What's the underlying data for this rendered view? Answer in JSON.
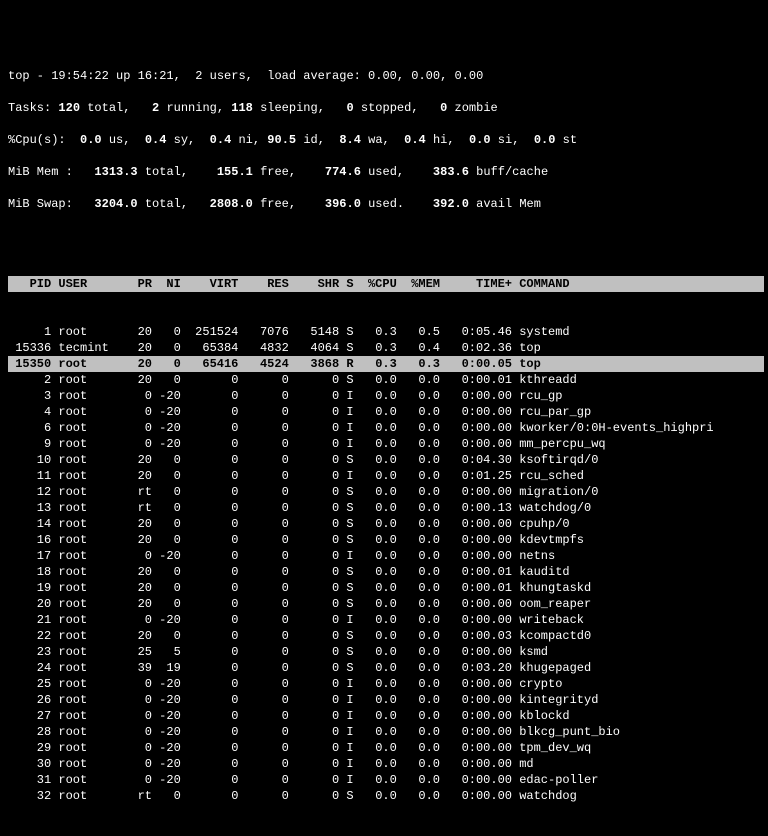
{
  "summary": {
    "line1": "top - 19:54:22 up 16:21,  2 users,  load average: 0.00, 0.00, 0.00",
    "tasks_prefix": "Tasks:",
    "tasks_total": "120",
    "tasks_running": "2",
    "tasks_sleeping": "118",
    "tasks_stopped": "0",
    "tasks_zombie": "0",
    "cpu_prefix": "%Cpu(s):",
    "cpu_us": "0.0",
    "cpu_sy": "0.4",
    "cpu_ni": "0.4",
    "cpu_id": "90.5",
    "cpu_wa": "8.4",
    "cpu_hi": "0.4",
    "cpu_si": "0.0",
    "cpu_st": "0.0",
    "mem_prefix": "MiB Mem :",
    "mem_total": "1313.3",
    "mem_free": "155.1",
    "mem_used": "774.6",
    "mem_buff": "383.6",
    "swap_prefix": "MiB Swap:",
    "swap_total": "3204.0",
    "swap_free": "2808.0",
    "swap_used": "396.0",
    "swap_avail": "392.0"
  },
  "headers": {
    "pid": "PID",
    "user": "USER",
    "pr": "PR",
    "ni": "NI",
    "virt": "VIRT",
    "res": "RES",
    "shr": "SHR",
    "s": "S",
    "cpu": "%CPU",
    "mem": "%MEM",
    "time": "TIME+",
    "cmd": "COMMAND"
  },
  "highlight_pid": 15350,
  "processes": [
    {
      "pid": "1",
      "user": "root",
      "pr": "20",
      "ni": "0",
      "virt": "251524",
      "res": "7076",
      "shr": "5148",
      "s": "S",
      "cpu": "0.3",
      "mem": "0.5",
      "time": "0:05.46",
      "cmd": "systemd"
    },
    {
      "pid": "15336",
      "user": "tecmint",
      "pr": "20",
      "ni": "0",
      "virt": "65384",
      "res": "4832",
      "shr": "4064",
      "s": "S",
      "cpu": "0.3",
      "mem": "0.4",
      "time": "0:02.36",
      "cmd": "top"
    },
    {
      "pid": "15350",
      "user": "root",
      "pr": "20",
      "ni": "0",
      "virt": "65416",
      "res": "4524",
      "shr": "3868",
      "s": "R",
      "cpu": "0.3",
      "mem": "0.3",
      "time": "0:00.05",
      "cmd": "top"
    },
    {
      "pid": "2",
      "user": "root",
      "pr": "20",
      "ni": "0",
      "virt": "0",
      "res": "0",
      "shr": "0",
      "s": "S",
      "cpu": "0.0",
      "mem": "0.0",
      "time": "0:00.01",
      "cmd": "kthreadd"
    },
    {
      "pid": "3",
      "user": "root",
      "pr": "0",
      "ni": "-20",
      "virt": "0",
      "res": "0",
      "shr": "0",
      "s": "I",
      "cpu": "0.0",
      "mem": "0.0",
      "time": "0:00.00",
      "cmd": "rcu_gp"
    },
    {
      "pid": "4",
      "user": "root",
      "pr": "0",
      "ni": "-20",
      "virt": "0",
      "res": "0",
      "shr": "0",
      "s": "I",
      "cpu": "0.0",
      "mem": "0.0",
      "time": "0:00.00",
      "cmd": "rcu_par_gp"
    },
    {
      "pid": "6",
      "user": "root",
      "pr": "0",
      "ni": "-20",
      "virt": "0",
      "res": "0",
      "shr": "0",
      "s": "I",
      "cpu": "0.0",
      "mem": "0.0",
      "time": "0:00.00",
      "cmd": "kworker/0:0H-events_highpri"
    },
    {
      "pid": "9",
      "user": "root",
      "pr": "0",
      "ni": "-20",
      "virt": "0",
      "res": "0",
      "shr": "0",
      "s": "I",
      "cpu": "0.0",
      "mem": "0.0",
      "time": "0:00.00",
      "cmd": "mm_percpu_wq"
    },
    {
      "pid": "10",
      "user": "root",
      "pr": "20",
      "ni": "0",
      "virt": "0",
      "res": "0",
      "shr": "0",
      "s": "S",
      "cpu": "0.0",
      "mem": "0.0",
      "time": "0:04.30",
      "cmd": "ksoftirqd/0"
    },
    {
      "pid": "11",
      "user": "root",
      "pr": "20",
      "ni": "0",
      "virt": "0",
      "res": "0",
      "shr": "0",
      "s": "I",
      "cpu": "0.0",
      "mem": "0.0",
      "time": "0:01.25",
      "cmd": "rcu_sched"
    },
    {
      "pid": "12",
      "user": "root",
      "pr": "rt",
      "ni": "0",
      "virt": "0",
      "res": "0",
      "shr": "0",
      "s": "S",
      "cpu": "0.0",
      "mem": "0.0",
      "time": "0:00.00",
      "cmd": "migration/0"
    },
    {
      "pid": "13",
      "user": "root",
      "pr": "rt",
      "ni": "0",
      "virt": "0",
      "res": "0",
      "shr": "0",
      "s": "S",
      "cpu": "0.0",
      "mem": "0.0",
      "time": "0:00.13",
      "cmd": "watchdog/0"
    },
    {
      "pid": "14",
      "user": "root",
      "pr": "20",
      "ni": "0",
      "virt": "0",
      "res": "0",
      "shr": "0",
      "s": "S",
      "cpu": "0.0",
      "mem": "0.0",
      "time": "0:00.00",
      "cmd": "cpuhp/0"
    },
    {
      "pid": "16",
      "user": "root",
      "pr": "20",
      "ni": "0",
      "virt": "0",
      "res": "0",
      "shr": "0",
      "s": "S",
      "cpu": "0.0",
      "mem": "0.0",
      "time": "0:00.00",
      "cmd": "kdevtmpfs"
    },
    {
      "pid": "17",
      "user": "root",
      "pr": "0",
      "ni": "-20",
      "virt": "0",
      "res": "0",
      "shr": "0",
      "s": "I",
      "cpu": "0.0",
      "mem": "0.0",
      "time": "0:00.00",
      "cmd": "netns"
    },
    {
      "pid": "18",
      "user": "root",
      "pr": "20",
      "ni": "0",
      "virt": "0",
      "res": "0",
      "shr": "0",
      "s": "S",
      "cpu": "0.0",
      "mem": "0.0",
      "time": "0:00.01",
      "cmd": "kauditd"
    },
    {
      "pid": "19",
      "user": "root",
      "pr": "20",
      "ni": "0",
      "virt": "0",
      "res": "0",
      "shr": "0",
      "s": "S",
      "cpu": "0.0",
      "mem": "0.0",
      "time": "0:00.01",
      "cmd": "khungtaskd"
    },
    {
      "pid": "20",
      "user": "root",
      "pr": "20",
      "ni": "0",
      "virt": "0",
      "res": "0",
      "shr": "0",
      "s": "S",
      "cpu": "0.0",
      "mem": "0.0",
      "time": "0:00.00",
      "cmd": "oom_reaper"
    },
    {
      "pid": "21",
      "user": "root",
      "pr": "0",
      "ni": "-20",
      "virt": "0",
      "res": "0",
      "shr": "0",
      "s": "I",
      "cpu": "0.0",
      "mem": "0.0",
      "time": "0:00.00",
      "cmd": "writeback"
    },
    {
      "pid": "22",
      "user": "root",
      "pr": "20",
      "ni": "0",
      "virt": "0",
      "res": "0",
      "shr": "0",
      "s": "S",
      "cpu": "0.0",
      "mem": "0.0",
      "time": "0:00.03",
      "cmd": "kcompactd0"
    },
    {
      "pid": "23",
      "user": "root",
      "pr": "25",
      "ni": "5",
      "virt": "0",
      "res": "0",
      "shr": "0",
      "s": "S",
      "cpu": "0.0",
      "mem": "0.0",
      "time": "0:00.00",
      "cmd": "ksmd"
    },
    {
      "pid": "24",
      "user": "root",
      "pr": "39",
      "ni": "19",
      "virt": "0",
      "res": "0",
      "shr": "0",
      "s": "S",
      "cpu": "0.0",
      "mem": "0.0",
      "time": "0:03.20",
      "cmd": "khugepaged"
    },
    {
      "pid": "25",
      "user": "root",
      "pr": "0",
      "ni": "-20",
      "virt": "0",
      "res": "0",
      "shr": "0",
      "s": "I",
      "cpu": "0.0",
      "mem": "0.0",
      "time": "0:00.00",
      "cmd": "crypto"
    },
    {
      "pid": "26",
      "user": "root",
      "pr": "0",
      "ni": "-20",
      "virt": "0",
      "res": "0",
      "shr": "0",
      "s": "I",
      "cpu": "0.0",
      "mem": "0.0",
      "time": "0:00.00",
      "cmd": "kintegrityd"
    },
    {
      "pid": "27",
      "user": "root",
      "pr": "0",
      "ni": "-20",
      "virt": "0",
      "res": "0",
      "shr": "0",
      "s": "I",
      "cpu": "0.0",
      "mem": "0.0",
      "time": "0:00.00",
      "cmd": "kblockd"
    },
    {
      "pid": "28",
      "user": "root",
      "pr": "0",
      "ni": "-20",
      "virt": "0",
      "res": "0",
      "shr": "0",
      "s": "I",
      "cpu": "0.0",
      "mem": "0.0",
      "time": "0:00.00",
      "cmd": "blkcg_punt_bio"
    },
    {
      "pid": "29",
      "user": "root",
      "pr": "0",
      "ni": "-20",
      "virt": "0",
      "res": "0",
      "shr": "0",
      "s": "I",
      "cpu": "0.0",
      "mem": "0.0",
      "time": "0:00.00",
      "cmd": "tpm_dev_wq"
    },
    {
      "pid": "30",
      "user": "root",
      "pr": "0",
      "ni": "-20",
      "virt": "0",
      "res": "0",
      "shr": "0",
      "s": "I",
      "cpu": "0.0",
      "mem": "0.0",
      "time": "0:00.00",
      "cmd": "md"
    },
    {
      "pid": "31",
      "user": "root",
      "pr": "0",
      "ni": "-20",
      "virt": "0",
      "res": "0",
      "shr": "0",
      "s": "I",
      "cpu": "0.0",
      "mem": "0.0",
      "time": "0:00.00",
      "cmd": "edac-poller"
    },
    {
      "pid": "32",
      "user": "root",
      "pr": "rt",
      "ni": "0",
      "virt": "0",
      "res": "0",
      "shr": "0",
      "s": "S",
      "cpu": "0.0",
      "mem": "0.0",
      "time": "0:00.00",
      "cmd": "watchdog"
    }
  ]
}
